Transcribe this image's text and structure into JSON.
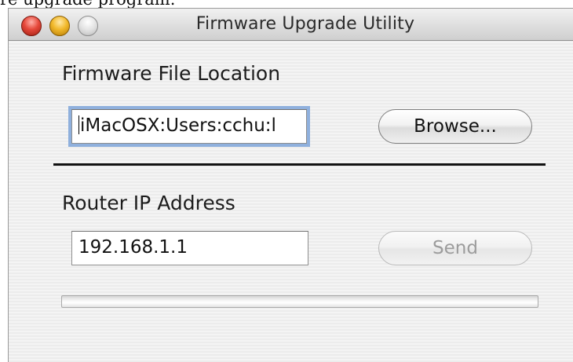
{
  "caption_fragment": "re upgrade program.",
  "window": {
    "title": "Firmware Upgrade Utility",
    "controls": [
      "close",
      "minimize",
      "zoom"
    ]
  },
  "firmware": {
    "section_label": "Firmware File Location",
    "file_path_value": "iMacOSX:Users:cchu:l",
    "browse_label": "Browse..."
  },
  "router": {
    "section_label": "Router IP Address",
    "ip_value": "192.168.1.1",
    "send_label": "Send",
    "send_enabled": false
  },
  "progress": {
    "fraction": 0
  },
  "colors": {
    "focus_ring": "#8fb0dd",
    "close_button": "#e6493b",
    "minimize_button": "#f2b92b",
    "zoom_button": "#d9d9d9",
    "disabled_text": "#9c9c9c"
  }
}
